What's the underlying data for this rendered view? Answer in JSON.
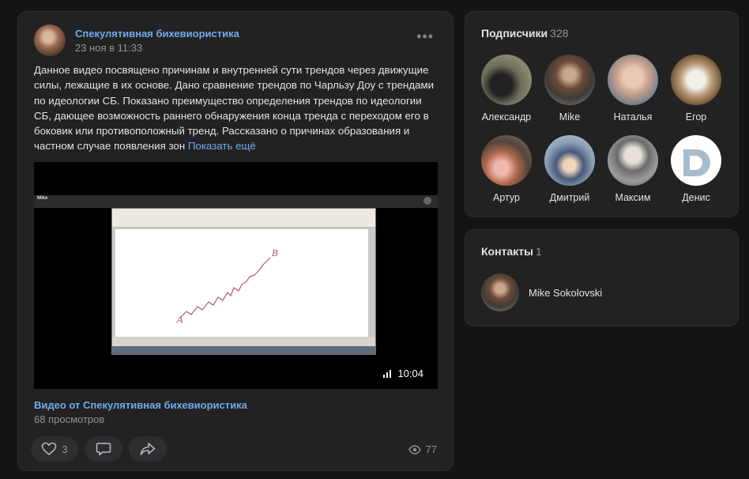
{
  "post": {
    "author": "Спекулятивная бихевиористика",
    "date": "23 ноя в 11:33",
    "text": "Данное видео посвящено причинам и внутренней сути трендов через движущие силы, лежащие в их основе. Дано сравнение трендов по Чарльзу Доу с трендами по идеологии СБ. Показано преимущество определения трендов по идеологии СБ, дающее возможность раннего обнаружения конца тренда с переходом его в боковик или противоположный тренд. Рассказано о причинах образования и частном случае появления зон",
    "show_more": "Показать ещё",
    "video": {
      "duration": "10:04",
      "title": "Видео от Спекулятивная бихевиористика",
      "views": "68 просмотров",
      "inner_window_title": "Mike",
      "chart_label_a": "A",
      "chart_label_b": "B"
    },
    "likes": "3",
    "views": "77",
    "icons": {
      "more": "more-dots-icon",
      "like": "heart-icon",
      "comment": "comment-icon",
      "share": "share-icon",
      "views": "eye-icon",
      "duration": "bars-icon"
    }
  },
  "subscribers": {
    "title": "Подписчики",
    "count": "328",
    "items": [
      {
        "name": "Александр"
      },
      {
        "name": "Mike"
      },
      {
        "name": "Наталья"
      },
      {
        "name": "Егор"
      },
      {
        "name": "Артур"
      },
      {
        "name": "Дмитрий"
      },
      {
        "name": "Максим"
      },
      {
        "name": "Денис"
      }
    ]
  },
  "contacts": {
    "title": "Контакты",
    "count": "1",
    "items": [
      {
        "name": "Mike Sokolovski"
      }
    ]
  },
  "colors": {
    "background": "#141414",
    "card": "#222222",
    "accent_link": "#71aaeb",
    "muted": "#939393",
    "text": "#e1e3e6"
  }
}
